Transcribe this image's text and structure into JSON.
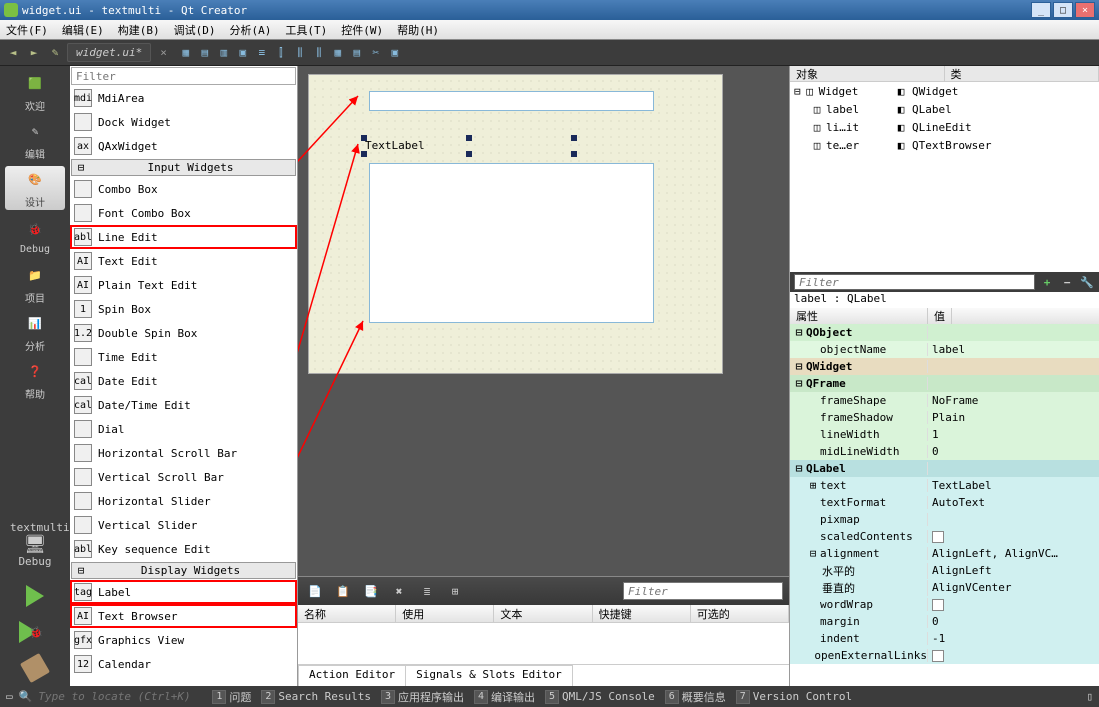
{
  "window": {
    "title": "widget.ui - textmulti - Qt Creator"
  },
  "menubar": [
    "文件(F)",
    "编辑(E)",
    "构建(B)",
    "调试(D)",
    "分析(A)",
    "工具(T)",
    "控件(W)",
    "帮助(H)"
  ],
  "tab": {
    "label": "widget.ui*"
  },
  "modes": [
    {
      "label": "欢迎",
      "icon": "qt"
    },
    {
      "label": "编辑",
      "icon": "edit"
    },
    {
      "label": "设计",
      "icon": "design",
      "selected": true
    },
    {
      "label": "Debug",
      "icon": "bug"
    },
    {
      "label": "项目",
      "icon": "proj"
    },
    {
      "label": "分析",
      "icon": "analysis"
    },
    {
      "label": "帮助",
      "icon": "help"
    }
  ],
  "target": {
    "name": "textmulti",
    "kit_icon": "desktop",
    "config": "Debug"
  },
  "widgetbox": {
    "filter_placeholder": "Filter",
    "preItems": [
      {
        "label": "MdiArea",
        "icon": "mdi"
      },
      {
        "label": "Dock Widget",
        "icon": "dock"
      },
      {
        "label": "QAxWidget",
        "icon": "ax"
      }
    ],
    "catInput": "Input Widgets",
    "inputItems": [
      {
        "label": "Combo Box",
        "icon": "combo"
      },
      {
        "label": "Font Combo Box",
        "icon": "font"
      },
      {
        "label": "Line Edit",
        "icon": "abl",
        "highlight": true
      },
      {
        "label": "Text Edit",
        "icon": "AI"
      },
      {
        "label": "Plain Text Edit",
        "icon": "AI"
      },
      {
        "label": "Spin Box",
        "icon": "1"
      },
      {
        "label": "Double Spin Box",
        "icon": "1.2"
      },
      {
        "label": "Time Edit",
        "icon": "clock"
      },
      {
        "label": "Date Edit",
        "icon": "cal"
      },
      {
        "label": "Date/Time Edit",
        "icon": "cal"
      },
      {
        "label": "Dial",
        "icon": "dial"
      },
      {
        "label": "Horizontal Scroll Bar",
        "icon": "hbar"
      },
      {
        "label": "Vertical Scroll Bar",
        "icon": "vbar"
      },
      {
        "label": "Horizontal Slider",
        "icon": "hslider"
      },
      {
        "label": "Vertical Slider",
        "icon": "vslider"
      },
      {
        "label": "Key sequence Edit",
        "icon": "abl"
      }
    ],
    "catDisplay": "Display Widgets",
    "displayItems": [
      {
        "label": "Label",
        "icon": "tag",
        "highlight": true
      },
      {
        "label": "Text Browser",
        "icon": "AI",
        "highlight": true
      },
      {
        "label": "Graphics View",
        "icon": "gfx"
      },
      {
        "label": "Calendar",
        "icon": "12"
      }
    ]
  },
  "locator_placeholder": "Type to locate (Ctrl+K)",
  "canvas": {
    "label_text": "TextLabel"
  },
  "action_panel": {
    "filter_placeholder": "Filter",
    "columns": [
      "名称",
      "使用",
      "文本",
      "快捷键",
      "可选的"
    ],
    "tabs": [
      "Action Editor",
      "Signals & Slots Editor"
    ]
  },
  "object_tree": {
    "headers": [
      "对象",
      "类"
    ],
    "rows": [
      {
        "name": "Widget",
        "cls": "QWidget",
        "depth": 0,
        "icon": "form"
      },
      {
        "name": "label",
        "cls": "QLabel",
        "depth": 1,
        "icon": "tag"
      },
      {
        "name": "li…it",
        "cls": "QLineEdit",
        "depth": 1,
        "icon": "abl"
      },
      {
        "name": "te…er",
        "cls": "QTextBrowser",
        "depth": 1,
        "icon": "AI"
      }
    ]
  },
  "props": {
    "filter_placeholder": "Filter",
    "title": "label : QLabel",
    "headers": [
      "属性",
      "值"
    ],
    "cats": [
      {
        "name": "QObject",
        "cls": "qobj",
        "rows": [
          {
            "n": "objectName",
            "v": "label"
          }
        ]
      },
      {
        "name": "QWidget",
        "cls": "qwid",
        "rows": []
      },
      {
        "name": "QFrame",
        "cls": "qfrm",
        "rows": [
          {
            "n": "frameShape",
            "v": "NoFrame"
          },
          {
            "n": "frameShadow",
            "v": "Plain"
          },
          {
            "n": "lineWidth",
            "v": "1"
          },
          {
            "n": "midLineWidth",
            "v": "0"
          }
        ]
      },
      {
        "name": "QLabel",
        "cls": "qlbl",
        "rows": [
          {
            "n": "text",
            "v": "TextLabel",
            "exp": "+"
          },
          {
            "n": "textFormat",
            "v": "AutoText"
          },
          {
            "n": "pixmap",
            "v": ""
          },
          {
            "n": "scaledContents",
            "v": "",
            "check": true
          },
          {
            "n": "alignment",
            "v": "AlignLeft, AlignVC…",
            "exp": "-",
            "children": [
              {
                "n": "水平的",
                "v": "AlignLeft"
              },
              {
                "n": "垂直的",
                "v": "AlignVCenter"
              }
            ]
          },
          {
            "n": "wordWrap",
            "v": "",
            "check": true
          },
          {
            "n": "margin",
            "v": "0"
          },
          {
            "n": "indent",
            "v": "-1"
          },
          {
            "n": "openExternalLinks",
            "v": "",
            "check": true
          }
        ]
      }
    ]
  },
  "statusbar": [
    {
      "n": "1",
      "label": "问题"
    },
    {
      "n": "2",
      "label": "Search Results"
    },
    {
      "n": "3",
      "label": "应用程序输出"
    },
    {
      "n": "4",
      "label": "编译输出"
    },
    {
      "n": "5",
      "label": "QML/JS Console"
    },
    {
      "n": "6",
      "label": "概要信息"
    },
    {
      "n": "7",
      "label": "Version Control"
    }
  ]
}
